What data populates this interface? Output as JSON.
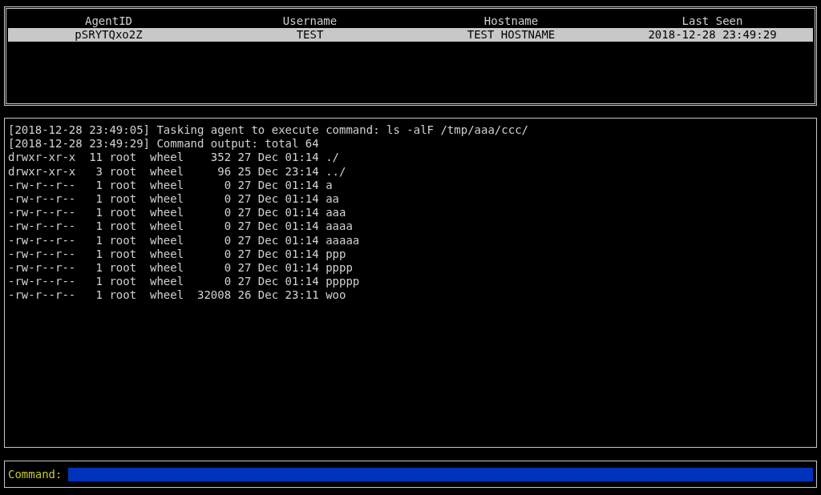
{
  "agents_table": {
    "columns": [
      "AgentID",
      "Username",
      "Hostname",
      "Last Seen"
    ],
    "rows": [
      {
        "cells": [
          "pSRYTQxo2Z",
          "TEST",
          "TEST HOSTNAME",
          "2018-12-28 23:49:29"
        ],
        "selected": true
      }
    ]
  },
  "log": [
    "[2018-12-28 23:49:05] Tasking agent to execute command: ls -alF /tmp/aaa/ccc/",
    "[2018-12-28 23:49:29] Command output: total 64",
    "drwxr-xr-x  11 root  wheel    352 27 Dec 01:14 ./",
    "drwxr-xr-x   3 root  wheel     96 25 Dec 23:14 ../",
    "-rw-r--r--   1 root  wheel      0 27 Dec 01:14 a",
    "-rw-r--r--   1 root  wheel      0 27 Dec 01:14 aa",
    "-rw-r--r--   1 root  wheel      0 27 Dec 01:14 aaa",
    "-rw-r--r--   1 root  wheel      0 27 Dec 01:14 aaaa",
    "-rw-r--r--   1 root  wheel      0 27 Dec 01:14 aaaaa",
    "-rw-r--r--   1 root  wheel      0 27 Dec 01:14 ppp",
    "-rw-r--r--   1 root  wheel      0 27 Dec 01:14 pppp",
    "-rw-r--r--   1 root  wheel      0 27 Dec 01:14 ppppp",
    "-rw-r--r--   1 root  wheel  32008 26 Dec 23:11 woo"
  ],
  "command": {
    "label": "Command:"
  }
}
